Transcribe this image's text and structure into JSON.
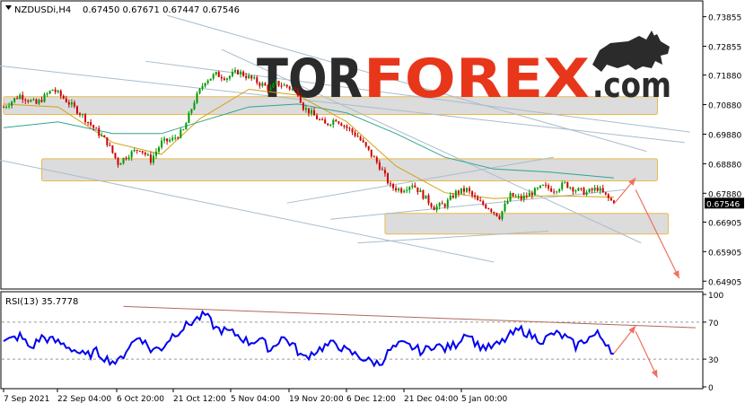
{
  "header": {
    "symbol": "NZDUSDi,H4",
    "ohlc": "0.67450 0.67671 0.67447 0.67546"
  },
  "logo": {
    "text_dark": "TOR",
    "text_orange": "FOREX",
    "suffix": ".com",
    "bull_icon": "bull-icon"
  },
  "rsi": {
    "label": "RSI(13) 35.7778"
  },
  "colors": {
    "candle_up": "#009900",
    "candle_down": "#cc0000",
    "ma_fast": "#d4a017",
    "ma_slow": "#2fa58f",
    "trendline": "#a9bccc",
    "zone_fill": "#dcdcdc",
    "zone_border": "#e9b94a",
    "arrow": "#f07060",
    "rsi_line": "#0000ee",
    "rsi_trend": "#b06a5a",
    "logo_dark": "#2b2b2b",
    "logo_orange": "#e8361a",
    "current_price_box": "#000000"
  },
  "chart_data": [
    {
      "type": "candlestick",
      "title": "",
      "current_price": 0.67546,
      "ylim": [
        0.647,
        0.743
      ],
      "y_ticks": [
        "0.73855",
        "0.72855",
        "0.71880",
        "0.70880",
        "0.69880",
        "0.68880",
        "0.67880",
        "0.66905",
        "0.65905",
        "0.64905"
      ],
      "x_ticks": [
        "7 Sep 2021",
        "22 Sep 04:00",
        "6 Oct 20:00",
        "21 Oct 12:00",
        "5 Nov 04:00",
        "19 Nov 20:00",
        "6 Dec 12:00",
        "21 Dec 04:00",
        "5 Jan 00:00"
      ],
      "price_path": [
        [
          0,
          0.708
        ],
        [
          6,
          0.712
        ],
        [
          12,
          0.709
        ],
        [
          18,
          0.714
        ],
        [
          22,
          0.711
        ],
        [
          28,
          0.706
        ],
        [
          34,
          0.7
        ],
        [
          38,
          0.696
        ],
        [
          42,
          0.689
        ],
        [
          46,
          0.692
        ],
        [
          50,
          0.694
        ],
        [
          54,
          0.69
        ],
        [
          58,
          0.696
        ],
        [
          62,
          0.697
        ],
        [
          66,
          0.7
        ],
        [
          70,
          0.71
        ],
        [
          74,
          0.717
        ],
        [
          78,
          0.719
        ],
        [
          82,
          0.718
        ],
        [
          86,
          0.72
        ],
        [
          90,
          0.718
        ],
        [
          94,
          0.716
        ],
        [
          98,
          0.714
        ],
        [
          100,
          0.716
        ],
        [
          104,
          0.715
        ],
        [
          108,
          0.713
        ],
        [
          110,
          0.708
        ],
        [
          114,
          0.705
        ],
        [
          118,
          0.702
        ],
        [
          122,
          0.704
        ],
        [
          126,
          0.701
        ],
        [
          130,
          0.698
        ],
        [
          134,
          0.693
        ],
        [
          138,
          0.688
        ],
        [
          142,
          0.681
        ],
        [
          146,
          0.68
        ],
        [
          150,
          0.682
        ],
        [
          154,
          0.678
        ],
        [
          158,
          0.674
        ],
        [
          162,
          0.675
        ],
        [
          166,
          0.679
        ],
        [
          170,
          0.68
        ],
        [
          174,
          0.676
        ],
        [
          178,
          0.674
        ],
        [
          182,
          0.671
        ],
        [
          186,
          0.678
        ],
        [
          190,
          0.677
        ],
        [
          194,
          0.679
        ],
        [
          198,
          0.681
        ],
        [
          202,
          0.68
        ],
        [
          206,
          0.682
        ],
        [
          210,
          0.68
        ],
        [
          214,
          0.679
        ],
        [
          218,
          0.6805
        ],
        [
          222,
          0.677
        ],
        [
          224,
          0.67546
        ]
      ],
      "ma_fast": [
        [
          0,
          0.709
        ],
        [
          20,
          0.708
        ],
        [
          40,
          0.696
        ],
        [
          58,
          0.692
        ],
        [
          72,
          0.704
        ],
        [
          90,
          0.714
        ],
        [
          108,
          0.712
        ],
        [
          126,
          0.703
        ],
        [
          144,
          0.688
        ],
        [
          162,
          0.679
        ],
        [
          180,
          0.677
        ],
        [
          200,
          0.678
        ],
        [
          224,
          0.6775
        ]
      ],
      "ma_slow": [
        [
          0,
          0.701
        ],
        [
          20,
          0.703
        ],
        [
          40,
          0.699
        ],
        [
          58,
          0.699
        ],
        [
          72,
          0.703
        ],
        [
          90,
          0.708
        ],
        [
          108,
          0.709
        ],
        [
          126,
          0.706
        ],
        [
          144,
          0.699
        ],
        [
          162,
          0.691
        ],
        [
          180,
          0.687
        ],
        [
          200,
          0.686
        ],
        [
          224,
          0.684
        ]
      ],
      "zones": [
        {
          "name": "upper-resistance-zone",
          "x": [
            0,
            240
          ],
          "y": [
            0.7055,
            0.7115
          ]
        },
        {
          "name": "middle-zone",
          "x": [
            14,
            240
          ],
          "y": [
            0.683,
            0.6905
          ]
        },
        {
          "name": "lower-support-zone",
          "x": [
            140,
            244
          ],
          "y": [
            0.665,
            0.672
          ]
        }
      ],
      "trendlines": [
        {
          "x": [
            -4,
            250
          ],
          "y": [
            0.7222,
            0.696
          ]
        },
        {
          "x": [
            52,
            252
          ],
          "y": [
            0.7235,
            0.6995
          ]
        },
        {
          "x": [
            60,
            236
          ],
          "y": [
            0.739,
            0.693
          ]
        },
        {
          "x": [
            80,
            234
          ],
          "y": [
            0.7275,
            0.662
          ]
        },
        {
          "x": [
            -4,
            180
          ],
          "y": [
            0.6905,
            0.6555
          ]
        },
        {
          "x": [
            130,
            200
          ],
          "y": [
            0.662,
            0.666
          ]
        },
        {
          "x": [
            104,
            202
          ],
          "y": [
            0.6755,
            0.691
          ]
        },
        {
          "x": [
            120,
            228
          ],
          "y": [
            0.67,
            0.68
          ]
        }
      ],
      "forecast_arrows": [
        {
          "x": [
            224,
            232
          ],
          "y": [
            0.6752,
            0.684
          ]
        },
        {
          "x": [
            232,
            248
          ],
          "y": [
            0.68,
            0.65
          ]
        }
      ]
    },
    {
      "type": "line",
      "title": "",
      "series_label": "RSI(13) 35.7778",
      "current_value": 35.7778,
      "ylim": [
        0,
        100
      ],
      "y_ticks": [
        "100",
        "70",
        "30",
        "0"
      ],
      "levels": [
        70,
        30
      ],
      "path": [
        [
          0,
          48
        ],
        [
          6,
          55
        ],
        [
          10,
          42
        ],
        [
          14,
          54
        ],
        [
          18,
          50
        ],
        [
          22,
          46
        ],
        [
          26,
          40
        ],
        [
          30,
          33
        ],
        [
          34,
          38
        ],
        [
          38,
          30
        ],
        [
          42,
          26
        ],
        [
          46,
          44
        ],
        [
          50,
          55
        ],
        [
          54,
          40
        ],
        [
          58,
          42
        ],
        [
          62,
          56
        ],
        [
          66,
          64
        ],
        [
          70,
          72
        ],
        [
          74,
          78
        ],
        [
          78,
          63
        ],
        [
          82,
          60
        ],
        [
          86,
          56
        ],
        [
          90,
          48
        ],
        [
          94,
          52
        ],
        [
          98,
          40
        ],
        [
          102,
          54
        ],
        [
          106,
          46
        ],
        [
          110,
          31
        ],
        [
          114,
          38
        ],
        [
          118,
          44
        ],
        [
          122,
          47
        ],
        [
          126,
          38
        ],
        [
          130,
          34
        ],
        [
          134,
          28
        ],
        [
          138,
          25
        ],
        [
          142,
          40
        ],
        [
          146,
          46
        ],
        [
          150,
          43
        ],
        [
          154,
          38
        ],
        [
          158,
          46
        ],
        [
          162,
          41
        ],
        [
          166,
          46
        ],
        [
          170,
          60
        ],
        [
          174,
          45
        ],
        [
          178,
          42
        ],
        [
          182,
          46
        ],
        [
          186,
          56
        ],
        [
          190,
          62
        ],
        [
          194,
          55
        ],
        [
          198,
          50
        ],
        [
          202,
          58
        ],
        [
          206,
          54
        ],
        [
          210,
          44
        ],
        [
          214,
          52
        ],
        [
          218,
          57
        ],
        [
          222,
          46
        ],
        [
          224,
          35.7778
        ]
      ],
      "trendline": {
        "x": [
          44,
          254
        ],
        "y": [
          87,
          64
        ]
      },
      "forecast_arrows": [
        {
          "x": [
            224,
            232
          ],
          "y": [
            36,
            66
          ]
        },
        {
          "x": [
            232,
            240
          ],
          "y": [
            60,
            10
          ]
        }
      ]
    }
  ]
}
